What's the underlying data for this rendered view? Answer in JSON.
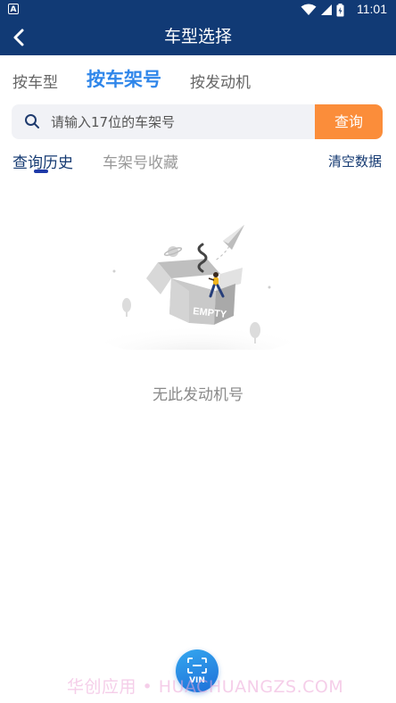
{
  "status_bar": {
    "time": "11:01",
    "app_icon_letter": "A"
  },
  "header": {
    "title": "车型选择",
    "back_icon": "chevron-left-icon"
  },
  "mode_tabs": [
    {
      "label": "按车型",
      "active": false
    },
    {
      "label": "按车架号",
      "active": true
    },
    {
      "label": "按发动机",
      "active": false
    }
  ],
  "search": {
    "placeholder": "请输入17位的车架号",
    "value": "",
    "button_label": "查询"
  },
  "sub_tabs": {
    "items": [
      {
        "label": "查询历史",
        "active": true
      },
      {
        "label": "车架号收藏",
        "active": false
      }
    ],
    "clear_label": "清空数据"
  },
  "empty_state": {
    "illustration_text": "EMPTY",
    "message": "无此发动机号"
  },
  "vin_button": {
    "label": "VIN"
  },
  "watermark": "华创应用 • HUACHUANGZS.COM",
  "colors": {
    "header_bg": "#113a75",
    "accent_blue": "#2f86ea",
    "search_button": "#fb8d3a",
    "tab_underline": "#1e3aa8"
  }
}
